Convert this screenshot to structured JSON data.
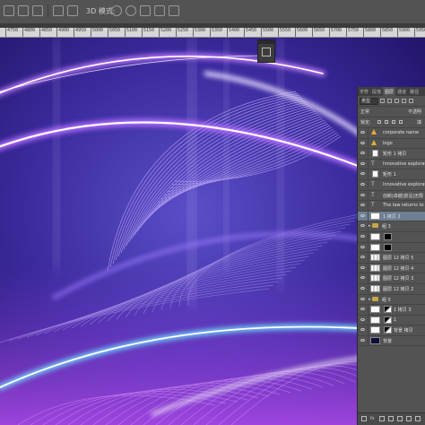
{
  "options_bar": {
    "mode_label": "3D 模式:"
  },
  "ruler": {
    "ticks": [
      "4750",
      "4800",
      "4850",
      "4900",
      "4950",
      "5000",
      "5050",
      "5100",
      "5150",
      "5200",
      "5250",
      "5300",
      "5350",
      "5400",
      "5450",
      "5500",
      "5550",
      "5600",
      "5650",
      "5700",
      "5750",
      "5800",
      "5850",
      "5900",
      "5950",
      "6000"
    ]
  },
  "layers_panel": {
    "tabs": [
      "字符",
      "段落",
      "图层",
      "通道",
      "路径"
    ],
    "active_tab": "图层",
    "filter_kind": "类型",
    "blend_mode": "正常",
    "opacity_label": "不透明",
    "lock_label": "锁定:",
    "fill_label": "填",
    "layers": [
      {
        "type": "warn",
        "name": "corporate name",
        "visible": true
      },
      {
        "type": "warn",
        "name": "logo",
        "visible": true
      },
      {
        "type": "rect",
        "name": "矩形 1 拷贝",
        "visible": true
      },
      {
        "type": "text",
        "name": "Innovative explorat",
        "visible": true
      },
      {
        "type": "rect",
        "name": "矩形 1",
        "visible": true
      },
      {
        "type": "text",
        "name": "Innovative explorati",
        "visible": true
      },
      {
        "type": "text",
        "name": "创新|卓越|前沿|无限",
        "visible": true
      },
      {
        "type": "text",
        "name": "The law returns to th",
        "visible": true
      },
      {
        "type": "smart",
        "name": "1 拷贝 2",
        "visible": true,
        "selected": true
      },
      {
        "type": "folder",
        "name": "组 3",
        "visible": true
      },
      {
        "type": "mask",
        "name": "",
        "visible": true
      },
      {
        "type": "mask",
        "name": "",
        "visible": true
      },
      {
        "type": "pattern",
        "name": "图层 12 拷贝 5",
        "visible": true
      },
      {
        "type": "pattern",
        "name": "图层 12 拷贝 4",
        "visible": true
      },
      {
        "type": "pattern",
        "name": "图层 12 拷贝 3",
        "visible": true
      },
      {
        "type": "pattern",
        "name": "图层 12 拷贝 2",
        "visible": true
      },
      {
        "type": "folder",
        "name": "组 5",
        "visible": true
      },
      {
        "type": "wave",
        "name": "1 拷贝 3",
        "visible": true
      },
      {
        "type": "wave",
        "name": "1",
        "visible": true
      },
      {
        "type": "wave",
        "name": "背景 拷贝",
        "visible": true
      },
      {
        "type": "dark",
        "name": "背景",
        "visible": true
      }
    ],
    "footer": {
      "fx": "fx"
    }
  },
  "colors": {
    "canvas_bg": "#2a1a6e",
    "glow_purple": "#b46cff",
    "glow_white": "#ffffff",
    "glow_blue": "#6fd7ff",
    "selected_row": "#6e7f94"
  }
}
